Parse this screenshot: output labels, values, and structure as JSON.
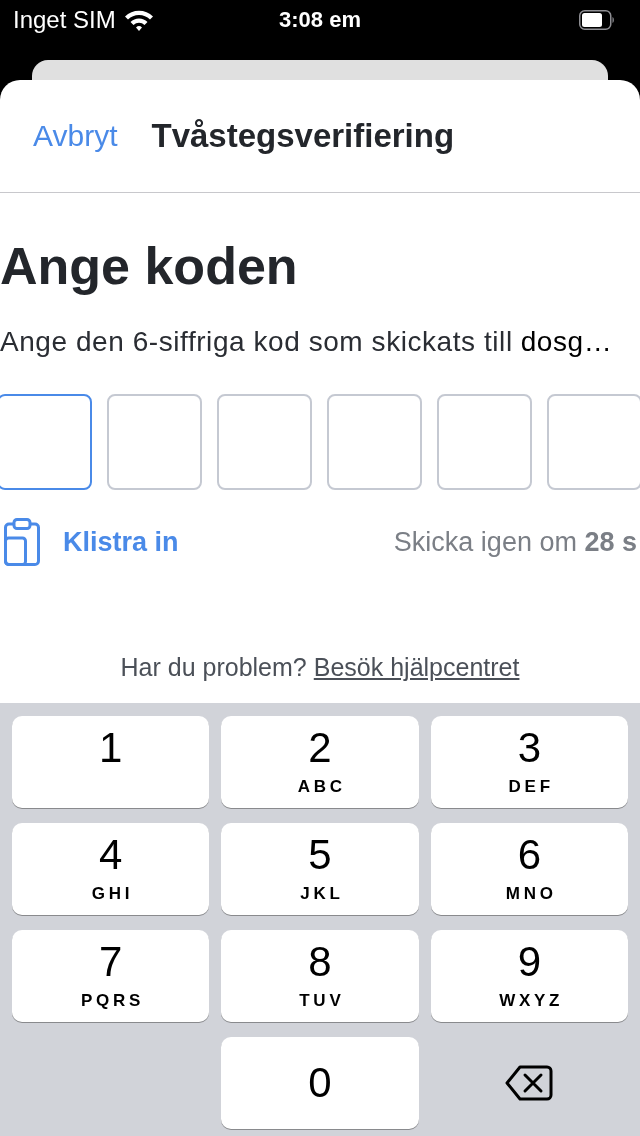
{
  "status_bar": {
    "carrier": "Inget SIM",
    "time": "3:08 em"
  },
  "header": {
    "cancel": "Avbryt",
    "title": "Tvåstegsverifiering"
  },
  "heading": "Ange koden",
  "instruction": {
    "text": "Ange den 6-siffriga kod som skickats till",
    "recipient": "dosg…"
  },
  "code_fields": [
    {
      "focused": true
    },
    {
      "focused": false
    },
    {
      "focused": false
    },
    {
      "focused": false
    },
    {
      "focused": false
    },
    {
      "focused": false
    }
  ],
  "paste_button": {
    "label": "Klistra in"
  },
  "resend": {
    "text": "Skicka igen om **28 s**"
  },
  "help": {
    "text": "Har du problem?",
    "link": "Besök hjälpcentret"
  },
  "keypad": {
    "keys": [
      {
        "kind": "digit",
        "digit": "1"
      },
      {
        "kind": "digit",
        "digit": "2",
        "letters": "ABC"
      },
      {
        "kind": "digit",
        "digit": "3",
        "letters": "DEF"
      },
      {
        "kind": "digit",
        "digit": "4",
        "letters": "GHI"
      },
      {
        "kind": "digit",
        "digit": "5",
        "letters": "JKL"
      },
      {
        "kind": "digit",
        "digit": "6",
        "letters": "MNO"
      },
      {
        "kind": "digit",
        "digit": "7",
        "letters": "PQRS"
      },
      {
        "kind": "digit",
        "digit": "8",
        "letters": "TUV"
      },
      {
        "kind": "digit",
        "digit": "9",
        "letters": "WXYZ"
      },
      {
        "kind": "digit",
        "digit": "0"
      },
      {
        "kind": "delete"
      }
    ]
  }
}
